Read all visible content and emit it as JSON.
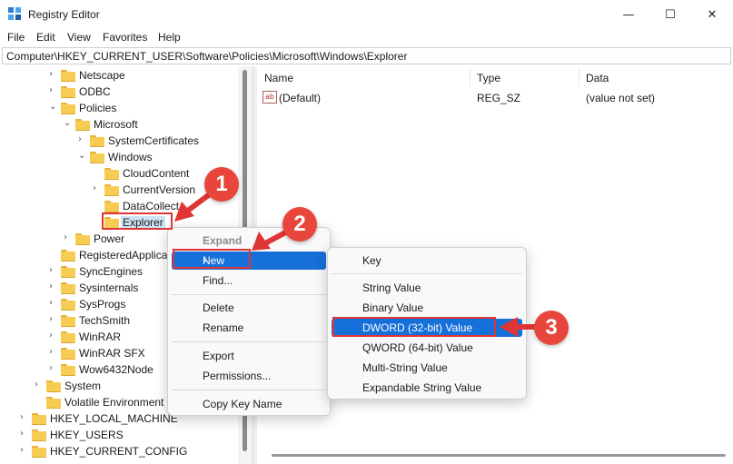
{
  "window": {
    "title": "Registry Editor",
    "minimize_glyph": "—",
    "maximize_glyph": "☐",
    "close_glyph": "✕"
  },
  "menu": [
    "File",
    "Edit",
    "View",
    "Favorites",
    "Help"
  ],
  "address": "Computer\\HKEY_CURRENT_USER\\Software\\Policies\\Microsoft\\Windows\\Explorer",
  "tree": [
    {
      "label": "Netscape",
      "level": 3,
      "chev": "›"
    },
    {
      "label": "ODBC",
      "level": 3,
      "chev": "›"
    },
    {
      "label": "Policies",
      "level": 3,
      "chev": "⌄"
    },
    {
      "label": "Microsoft",
      "level": 4,
      "chev": "⌄"
    },
    {
      "label": "SystemCertificates",
      "level": 5,
      "chev": "›"
    },
    {
      "label": "Windows",
      "level": 5,
      "chev": "⌄"
    },
    {
      "label": "CloudContent",
      "level": 6,
      "chev": ""
    },
    {
      "label": "CurrentVersion",
      "level": 6,
      "chev": "›"
    },
    {
      "label": "DataCollect",
      "level": 6,
      "chev": ""
    },
    {
      "label": "Explorer",
      "level": 6,
      "chev": "",
      "selected": true
    },
    {
      "label": "Power",
      "level": 4,
      "chev": "›"
    },
    {
      "label": "RegisteredApplica",
      "level": 3,
      "chev": ""
    },
    {
      "label": "SyncEngines",
      "level": 3,
      "chev": "›"
    },
    {
      "label": "Sysinternals",
      "level": 3,
      "chev": "›"
    },
    {
      "label": "SysProgs",
      "level": 3,
      "chev": "›"
    },
    {
      "label": "TechSmith",
      "level": 3,
      "chev": "›"
    },
    {
      "label": "WinRAR",
      "level": 3,
      "chev": "›"
    },
    {
      "label": "WinRAR SFX",
      "level": 3,
      "chev": "›"
    },
    {
      "label": "Wow6432Node",
      "level": 3,
      "chev": "›"
    },
    {
      "label": "System",
      "level": 2,
      "chev": "›"
    },
    {
      "label": "Volatile Environment",
      "level": 2,
      "chev": ""
    },
    {
      "label": "HKEY_LOCAL_MACHINE",
      "level": 1,
      "chev": "›"
    },
    {
      "label": "HKEY_USERS",
      "level": 1,
      "chev": "›"
    },
    {
      "label": "HKEY_CURRENT_CONFIG",
      "level": 1,
      "chev": "›"
    }
  ],
  "list": {
    "headers": {
      "name": "Name",
      "type": "Type",
      "data": "Data"
    },
    "rows": [
      {
        "icon": "ab",
        "name": "(Default)",
        "type": "REG_SZ",
        "data": "(value not set)"
      }
    ]
  },
  "context_menu": {
    "expand": "Expand",
    "new": "New",
    "new_arrow": "›",
    "find": "Find...",
    "delete": "Delete",
    "rename": "Rename",
    "export": "Export",
    "permissions": "Permissions...",
    "copy_key_name": "Copy Key Name"
  },
  "submenu": {
    "key": "Key",
    "string_value": "String Value",
    "binary_value": "Binary Value",
    "dword_value": "DWORD (32-bit) Value",
    "qword_value": "QWORD (64-bit) Value",
    "multi_string_value": "Multi-String Value",
    "expandable_string_value": "Expandable String Value"
  },
  "annotations": {
    "step1": "1",
    "step2": "2",
    "step3": "3",
    "color": "#e03535"
  }
}
